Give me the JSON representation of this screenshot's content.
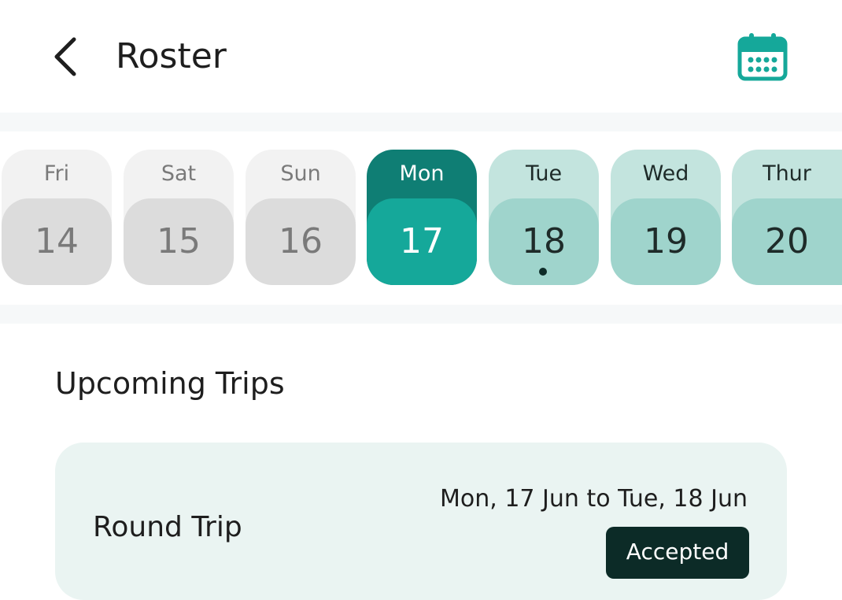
{
  "header": {
    "title": "Roster",
    "back_icon": "chevron-left-icon",
    "calendar_icon": "calendar-icon"
  },
  "days": [
    {
      "name": "Fri",
      "num": "14",
      "state": "past",
      "has_dot": false
    },
    {
      "name": "Sat",
      "num": "15",
      "state": "past",
      "has_dot": false
    },
    {
      "name": "Sun",
      "num": "16",
      "state": "past",
      "has_dot": false
    },
    {
      "name": "Mon",
      "num": "17",
      "state": "selected",
      "has_dot": false
    },
    {
      "name": "Tue",
      "num": "18",
      "state": "future",
      "has_dot": true
    },
    {
      "name": "Wed",
      "num": "19",
      "state": "future",
      "has_dot": false
    },
    {
      "name": "Thur",
      "num": "20",
      "state": "future",
      "has_dot": false
    }
  ],
  "upcoming": {
    "title": "Upcoming Trips",
    "trips": [
      {
        "type": "Round Trip",
        "dates": "Mon, 17 Jun to Tue, 18 Jun",
        "status": "Accepted"
      }
    ]
  },
  "colors": {
    "accent": "#15a89a",
    "accent_dark": "#0f7e74",
    "future_light": "#c3e4de",
    "future_mid": "#9fd4cc",
    "past_light": "#f2f2f2",
    "past_mid": "#dcdcdc",
    "status_bg": "#0c2b27",
    "card_bg": "#eaf4f2"
  }
}
